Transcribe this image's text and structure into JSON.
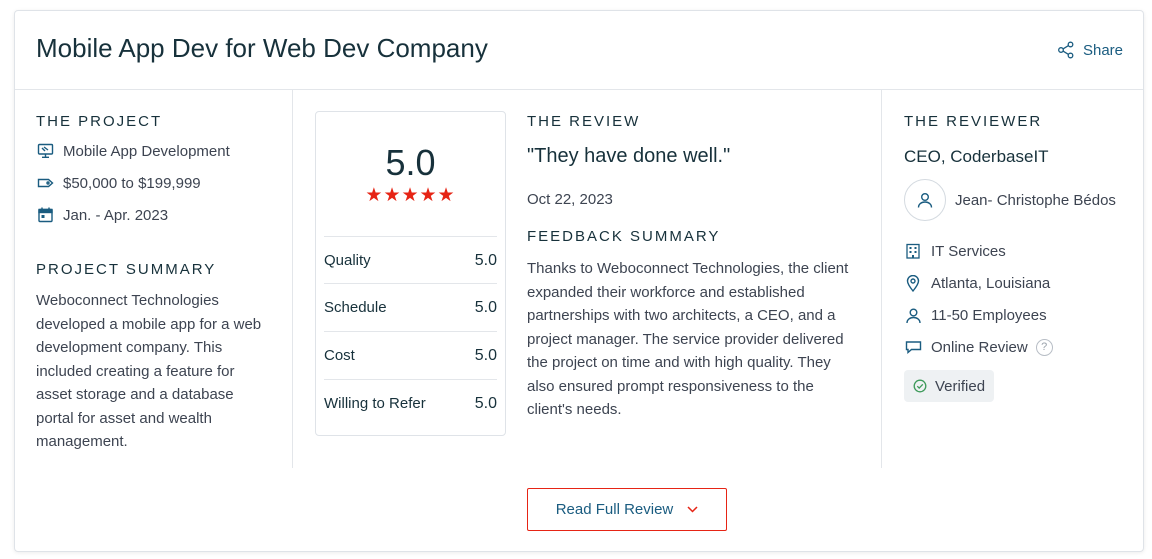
{
  "header": {
    "title": "Mobile App Dev for Web Dev Company",
    "share_label": "Share"
  },
  "project": {
    "heading": "THE PROJECT",
    "service": "Mobile App Development",
    "budget": "$50,000 to $199,999",
    "dates": "Jan. - Apr. 2023",
    "summary_heading": "PROJECT SUMMARY",
    "summary_lines": [
      "Weboconnect Technologies",
      "developed a mobile app for a web",
      "development company. This",
      "included creating a feature for",
      "asset storage and a database",
      "portal for asset and wealth",
      "management."
    ]
  },
  "rating": {
    "overall": "5.0",
    "stars": 5,
    "stars_text": "★★★★★",
    "rows": [
      {
        "label": "Quality",
        "value": "5.0"
      },
      {
        "label": "Schedule",
        "value": "5.0"
      },
      {
        "label": "Cost",
        "value": "5.0"
      },
      {
        "label": "Willing to Refer",
        "value": "5.0"
      }
    ]
  },
  "review": {
    "heading": "THE REVIEW",
    "quote": "\"They have done well.\"",
    "date": "Oct 22, 2023",
    "feedback_heading": "FEEDBACK SUMMARY",
    "feedback_lines": [
      "Thanks to Weboconnect Technologies, the client",
      "expanded their workforce and established",
      "partnerships with two architects, a CEO, and a",
      "project manager. The service provider delivered",
      "the project on time and with high quality. They",
      "also ensured prompt responsiveness to the",
      "client's needs."
    ]
  },
  "reviewer": {
    "heading": "THE REVIEWER",
    "title": "CEO, CoderbaseIT",
    "name": "Jean- Christophe Bédos",
    "industry": "IT Services",
    "location": "Atlanta, Louisiana",
    "size": "11-50 Employees",
    "review_type": "Online Review",
    "help_glyph": "?",
    "verified": "Verified"
  },
  "footer": {
    "read_full_label": "Read Full Review"
  },
  "colors": {
    "accent_red": "#e62415",
    "link_blue": "#1a5c80",
    "heading_dark": "#17313b",
    "body_text": "#3d4451"
  },
  "icons": [
    "share-icon",
    "monitor-icon",
    "tag-icon",
    "calendar-icon",
    "user-icon",
    "building-icon",
    "location-pin-icon",
    "chat-icon",
    "help-icon",
    "check-circle-icon",
    "chevron-down-icon"
  ]
}
